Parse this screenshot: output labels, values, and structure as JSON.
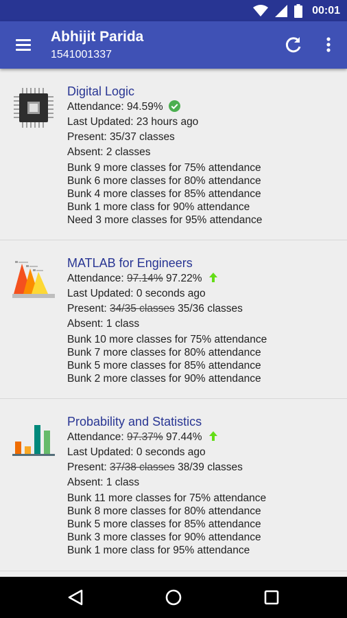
{
  "status_bar": {
    "time": "00:01"
  },
  "app_bar": {
    "title": "Abhijit Parida",
    "subtitle": "1541001337"
  },
  "subjects": [
    {
      "name": "Digital Logic",
      "attendance_label": "Attendance: ",
      "attendance": "94.59%",
      "attendance_old": "",
      "last_updated": "Last Updated: 23 hours ago",
      "present_label": "Present: ",
      "present_old": "",
      "present": "35/37 classes",
      "absent": "Absent: 2 classes",
      "bunk": [
        "Bunk 9 more classes for 75% attendance",
        "Bunk 6 more classes for 80% attendance",
        "Bunk 4 more classes for 85% attendance",
        "Bunk 1 more class for 90% attendance",
        "Need 3 more classes for 95% attendance"
      ]
    },
    {
      "name": "MATLAB for Engineers",
      "attendance_label": "Attendance: ",
      "attendance_old": "97.14%",
      "attendance": "97.22%",
      "last_updated": "Last Updated: 0 seconds ago",
      "present_label": "Present: ",
      "present_old": "34/35 classes",
      "present": "35/36 classes",
      "absent": "Absent: 1 class",
      "bunk": [
        "Bunk 10 more classes for 75% attendance",
        "Bunk 7 more classes for 80% attendance",
        "Bunk 5 more classes for 85% attendance",
        "Bunk 2 more classes for 90% attendance"
      ]
    },
    {
      "name": "Probability and Statistics",
      "attendance_label": "Attendance: ",
      "attendance_old": "97.37%",
      "attendance": "97.44%",
      "last_updated": "Last Updated: 0 seconds ago",
      "present_label": "Present: ",
      "present_old": "37/38 classes",
      "present": "38/39 classes",
      "absent": "Absent: 1 class",
      "bunk": [
        "Bunk 11 more classes for 75% attendance",
        "Bunk 8 more classes for 80% attendance",
        "Bunk 5 more classes for 85% attendance",
        "Bunk 3 more classes for 90% attendance",
        "Bunk 1 more class for 95% attendance"
      ]
    }
  ],
  "colors": {
    "primary": "#3f51b5",
    "primary_dark": "#283593",
    "ok_green": "#4caf50",
    "up_green": "#64dd17"
  }
}
